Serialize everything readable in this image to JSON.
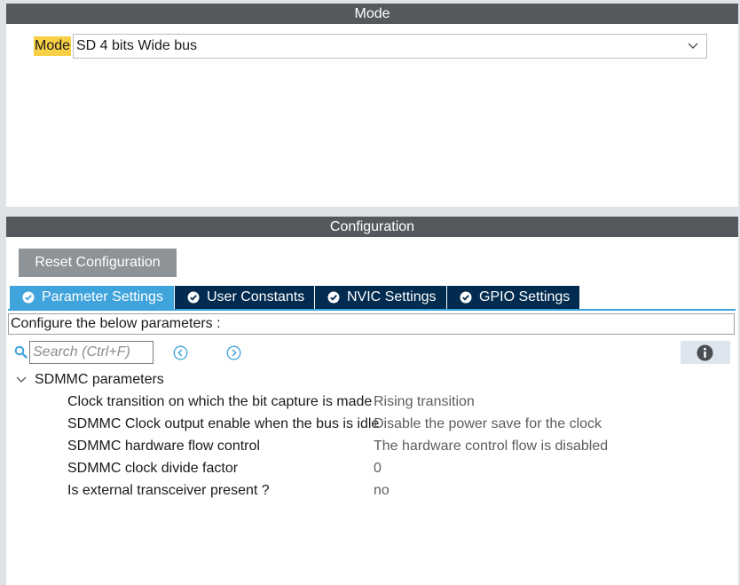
{
  "mode_panel": {
    "header": "Mode",
    "mode_label": "Mode",
    "mode_value": "SD 4 bits Wide bus"
  },
  "config_panel": {
    "header": "Configuration",
    "reset_label": "Reset Configuration",
    "tabs": [
      {
        "label": "Parameter Settings",
        "active": true
      },
      {
        "label": "User Constants",
        "active": false
      },
      {
        "label": "NVIC Settings",
        "active": false
      },
      {
        "label": "GPIO Settings",
        "active": false
      }
    ],
    "description": "Configure the below parameters :",
    "search_placeholder": "Search (Ctrl+F)",
    "group_label": "SDMMC parameters",
    "params": [
      {
        "name": "Clock transition on which the bit capture is made",
        "value": "Rising transition"
      },
      {
        "name": "SDMMC Clock output enable when the bus is idle",
        "value": "Disable the power save for the clock"
      },
      {
        "name": "SDMMC hardware flow control",
        "value": "The hardware control flow is disabled"
      },
      {
        "name": "SDMMC clock divide factor",
        "value": "0"
      },
      {
        "name": "Is external transceiver present ?",
        "value": "no"
      }
    ]
  },
  "colors": {
    "header_bg": "#55595e",
    "tab_active": "#3fa3dc",
    "tab_inactive": "#022b50",
    "mode_highlight": "#f7d046",
    "reset_button": "#8e9398",
    "icon_blue": "#3fa3dc"
  },
  "icons": {
    "dropdown": "chevron-down-icon",
    "tab_status": "check-circle-icon",
    "search": "search-icon",
    "prev": "arrow-left-circle-icon",
    "next": "arrow-right-circle-icon",
    "info": "info-icon",
    "group_expand": "chevron-down-icon"
  }
}
